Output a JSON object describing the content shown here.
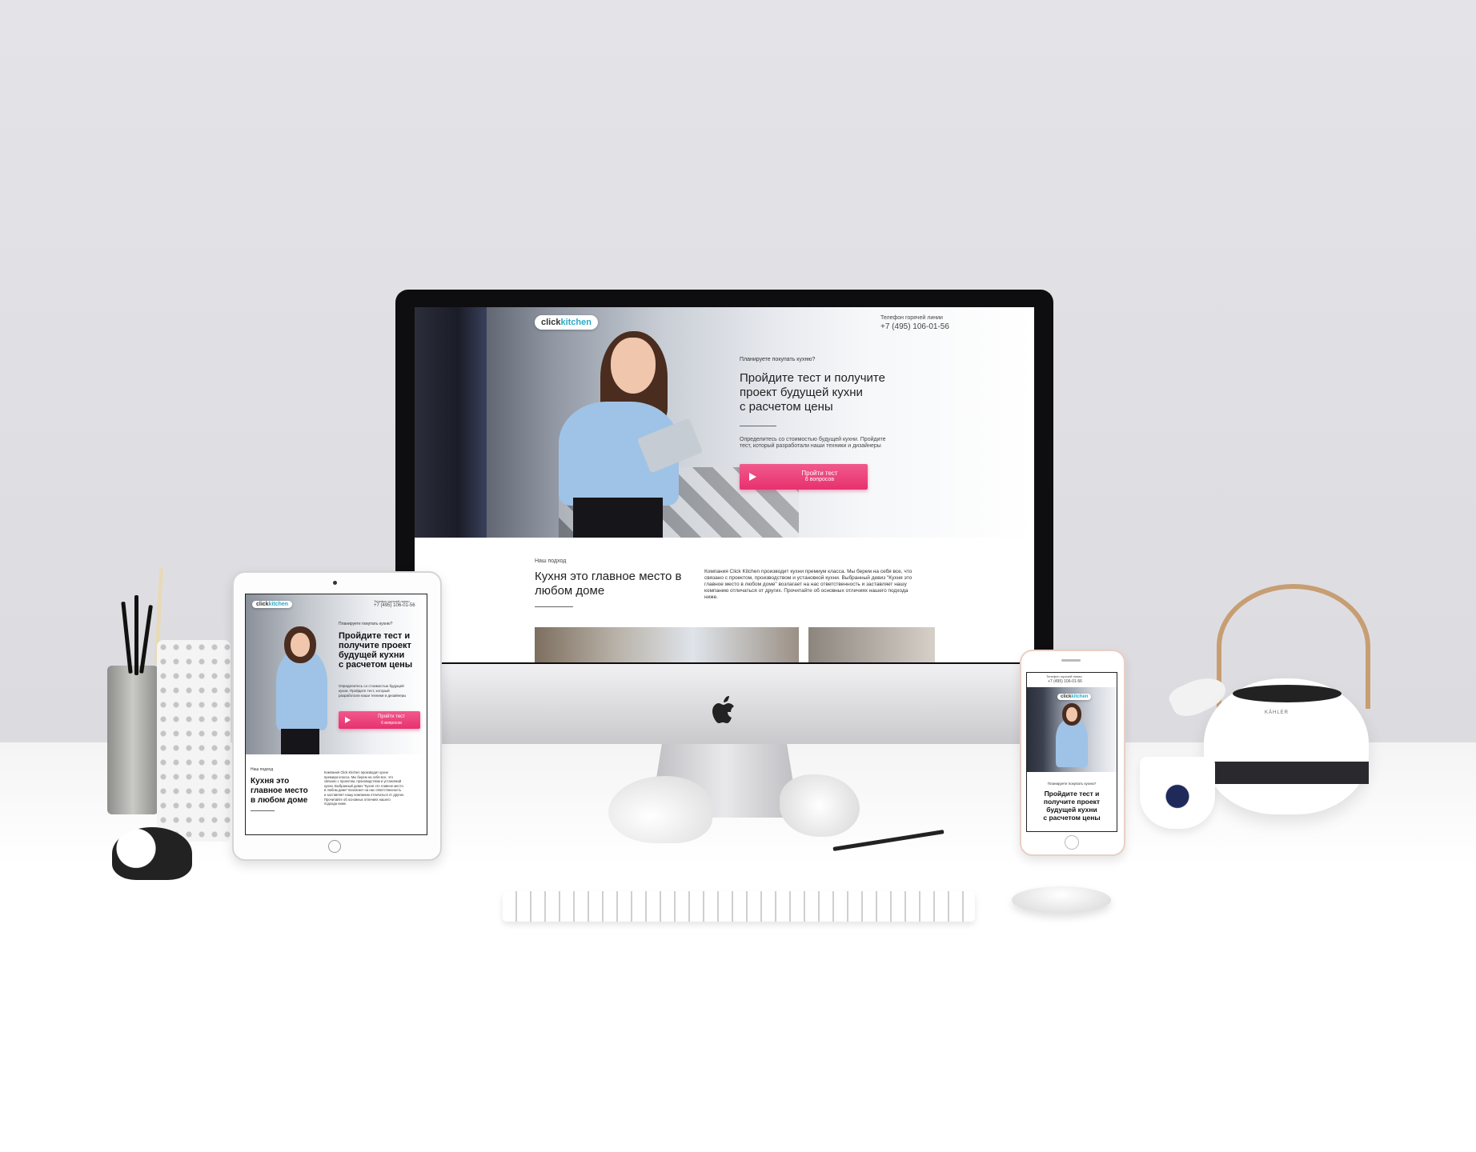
{
  "colors": {
    "accent_pink": "#e7316e",
    "logo_teal": "#2aa9c6",
    "wall": "#e2e2e6"
  },
  "site": {
    "logo_part1": "click",
    "logo_part2": "kitchen",
    "hotline_label": "Телефон горячей линии",
    "hotline_phone": "+7 (495) 106-01-56",
    "eyebrow": "Планируете покупать кухню?",
    "headline_lines": [
      "Пройдите тест и получите",
      "проект будущей кухни",
      "с расчетом цены"
    ],
    "subtext_lines": [
      "Определитесь со стоимостью будущей кухни. Пройдите",
      "тест, который разработали наши техники и дизайнеры"
    ],
    "cta_line1": "Пройти тест",
    "cta_line2": "6 вопросов",
    "section_eyebrow": "Наш подход",
    "section_title_lines": [
      "Кухня это главное место в",
      "любом доме"
    ],
    "section_body_lines": [
      "Компания Click Kitchen производит кухни премиум класса. Мы берем на себя все, что",
      "связано с проектом, производством и установкой кухни. Выбранный девиз \"Кухня это",
      "главное место в любом доме\" возлагает на нас ответственность и заставляет нашу",
      "компанию отличаться от других. Прочитайте об основных отличиях нашего подхода",
      "ниже."
    ]
  },
  "tablet": {
    "headline_lines": [
      "Пройдите тест и",
      "получите проект",
      "будущей кухни",
      "с расчетом цены"
    ],
    "subtext_lines": [
      "Определитесь со стоимостью будущей",
      "кухни. Пройдите тест, который",
      "разработали наши техники и дизайнеры"
    ],
    "section_title_lines": [
      "Кухня это",
      "главное место",
      "в любом доме"
    ],
    "section_body_lines": [
      "Компания Click Kitchen производит кухни",
      "премиум класса. Мы берем на себя все, что",
      "связано с проектом, производством и установкой",
      "кухни. Выбранный девиз \"Кухня это главное место",
      "в любом доме\" возлагает на нас ответственность",
      "и заставляет нашу компанию отличаться от других.",
      "Прочитайте об основных отличиях нашего",
      "подхода ниже."
    ]
  },
  "phone": {
    "headline_lines": [
      "Пройдите тест и",
      "получите проект",
      "будущей кухни",
      "с расчетом цены"
    ]
  },
  "props": {
    "teapot_brand": "KÄHLER"
  }
}
